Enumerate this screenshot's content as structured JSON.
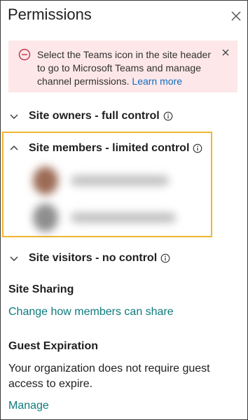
{
  "panel": {
    "title": "Permissions"
  },
  "notice": {
    "message": "Select the Teams icon in the site header to go to Microsoft Teams and manage channel permissions.",
    "link": "Learn more"
  },
  "groups": [
    {
      "label": "Site owners - full control",
      "expanded": false
    },
    {
      "label": "Site members - limited control",
      "expanded": true
    },
    {
      "label": "Site visitors - no control",
      "expanded": false
    }
  ],
  "site_sharing": {
    "title": "Site Sharing",
    "link": "Change how members can share"
  },
  "guest_expiration": {
    "title": "Guest Expiration",
    "text": "Your organization does not require guest access to expire.",
    "link": "Manage"
  },
  "colors": {
    "accent_link": "#0e7a7c",
    "notice_bg": "#fde7e9",
    "error_red": "#c4314b",
    "highlight_border": "#f0b630"
  }
}
